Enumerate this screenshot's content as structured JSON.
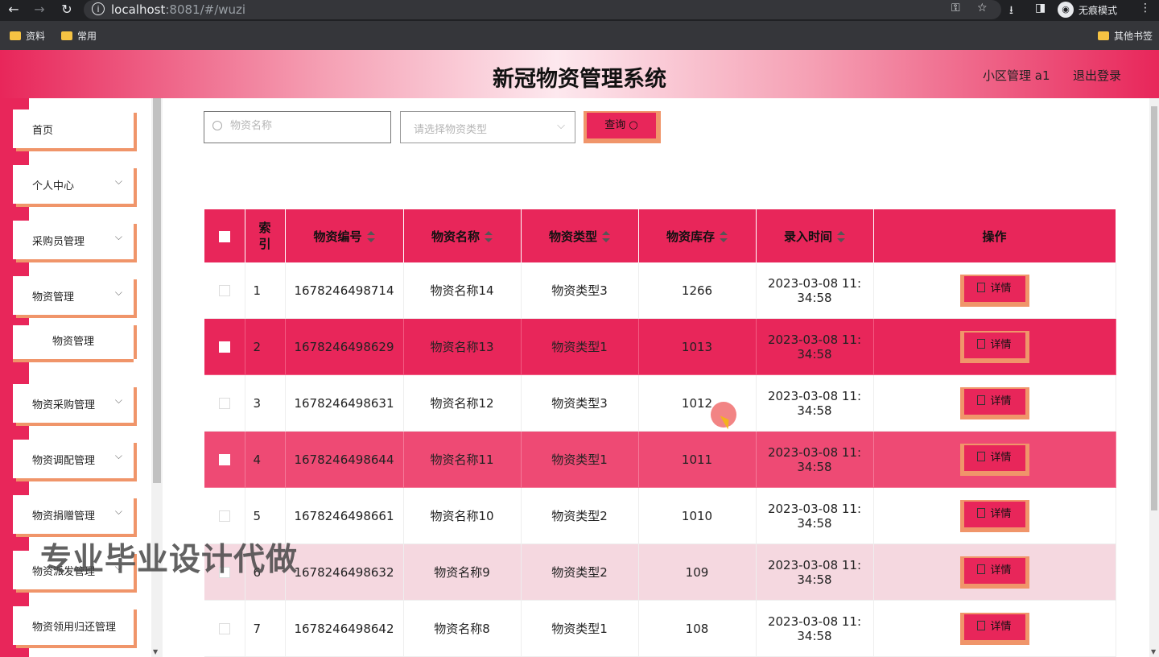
{
  "browser": {
    "url_host": "localhost",
    "url_port": ":8081/#/wuzi",
    "incognito_label": "无痕模式",
    "bookmarks": [
      "资料",
      "常用"
    ],
    "other_bookmarks": "其他书签"
  },
  "header": {
    "title": "新冠物资管理系统",
    "user": "小区管理 a1",
    "logout": "退出登录"
  },
  "sidebar": {
    "items": [
      {
        "label": "首页",
        "has_chevron": false
      },
      {
        "label": "个人中心",
        "has_chevron": true
      },
      {
        "label": "采购员管理",
        "has_chevron": true
      },
      {
        "label": "物资管理",
        "has_chevron": true
      },
      {
        "label": "物资采购管理",
        "has_chevron": true
      },
      {
        "label": "物资调配管理",
        "has_chevron": true
      },
      {
        "label": "物资捐赠管理",
        "has_chevron": true
      },
      {
        "label": "物资派发管理",
        "has_chevron": true
      },
      {
        "label": "物资领用归还管理",
        "has_chevron": false
      }
    ],
    "sub_item": "物资管理"
  },
  "filters": {
    "name_placeholder": "物资名称",
    "type_placeholder": "请选择物资类型",
    "query_label": "查询"
  },
  "table": {
    "headers": [
      "索引",
      "物资编号",
      "物资名称",
      "物资类型",
      "物资库存",
      "录入时间",
      "操作"
    ],
    "detail_label": "详情",
    "rows": [
      {
        "index": "1",
        "code": "1678246498714",
        "name": "物资名称14",
        "type": "物资类型3",
        "stock": "1266",
        "time_date": "2023-03-08 11:",
        "time_rest": "34:58",
        "style": "normal"
      },
      {
        "index": "2",
        "code": "1678246498629",
        "name": "物资名称13",
        "type": "物资类型1",
        "stock": "1013",
        "time_date": "2023-03-08 11:",
        "time_rest": "34:58",
        "style": "hl"
      },
      {
        "index": "3",
        "code": "1678246498631",
        "name": "物资名称12",
        "type": "物资类型3",
        "stock": "1012",
        "time_date": "2023-03-08 11:",
        "time_rest": "34:58",
        "style": "normal"
      },
      {
        "index": "4",
        "code": "1678246498644",
        "name": "物资名称11",
        "type": "物资类型1",
        "stock": "1011",
        "time_date": "2023-03-08 11:",
        "time_rest": "34:58",
        "style": "hl2"
      },
      {
        "index": "5",
        "code": "1678246498661",
        "name": "物资名称10",
        "type": "物资类型2",
        "stock": "1010",
        "time_date": "2023-03-08 11:",
        "time_rest": "34:58",
        "style": "normal"
      },
      {
        "index": "6",
        "code": "1678246498632",
        "name": "物资名称9",
        "type": "物资类型2",
        "stock": "109",
        "time_date": "2023-03-08 11:",
        "time_rest": "34:58",
        "style": "pink"
      },
      {
        "index": "7",
        "code": "1678246498642",
        "name": "物资名称8",
        "type": "物资类型1",
        "stock": "108",
        "time_date": "2023-03-08 11:",
        "time_rest": "34:58",
        "style": "normal"
      }
    ]
  },
  "watermark": "专业毕业设计代做",
  "colors": {
    "accent": "#e8265a",
    "accent_shadow": "#f0956a",
    "row_pink": "#f5d8e0"
  }
}
